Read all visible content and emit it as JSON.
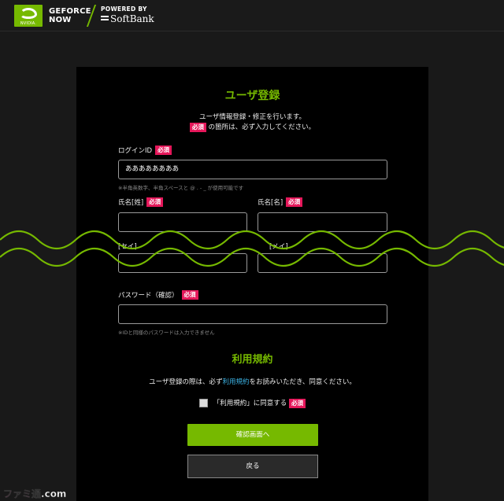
{
  "header": {
    "nvidia": "NVIDIA.",
    "geforce_line1": "GEFORCE",
    "geforce_line2": "NOW",
    "powered_by": "POWERED BY",
    "softbank": "SoftBank"
  },
  "form": {
    "title": "ユーザ登録",
    "intro_line1": "ユーザ情報登録・修正を行います。",
    "required_badge": "必須",
    "intro_line2": "の箇所は、必ず入力してください。",
    "login_id": {
      "label": "ログインID",
      "value": "ああああああああ",
      "note": "※半角英数字、半角スペースと @ . - _ が使用可能です"
    },
    "last_name": {
      "label": "氏名[姓]",
      "value": ""
    },
    "first_name": {
      "label": "氏名[名]",
      "value": ""
    },
    "last_kana": {
      "label": "[セイ]"
    },
    "first_kana": {
      "label": "[メイ]"
    },
    "password_confirm": {
      "label": "パスワード（確認）",
      "value": "",
      "note": "※IDと同様のパスワードは入力できません"
    }
  },
  "terms": {
    "title": "利用規約",
    "text_before": "ユーザ登録の際は、必ず",
    "link": "利用規約",
    "text_after": "をお読みいただき、同意ください。",
    "agree_label": "「利用規約」に同意する",
    "checked": false
  },
  "buttons": {
    "confirm": "確認画面へ",
    "back": "戻る"
  },
  "watermark": {
    "text_a": "ファミ",
    "text_b": "通.com"
  },
  "colors": {
    "accent": "#76b900",
    "required": "#e5175a",
    "link": "#3cb4e6"
  }
}
